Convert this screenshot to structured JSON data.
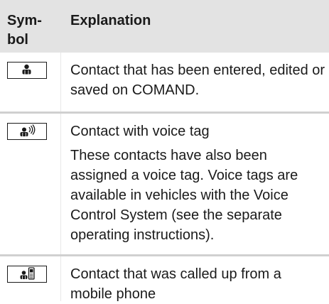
{
  "table": {
    "header": {
      "symbol": "Sym-\nbol",
      "explanation": "Explanation"
    },
    "rows": [
      {
        "icon": "contact-person-icon",
        "paragraphs": [
          "Contact that has been entered, edited or saved on COMAND."
        ]
      },
      {
        "icon": "contact-voice-tag-icon",
        "paragraphs": [
          "Contact with voice tag",
          "These contacts have also been assigned a voice tag. Voice tags are available in vehicles with the Voice Control System (see the separate operating instructions)."
        ]
      },
      {
        "icon": "contact-mobile-phone-icon",
        "paragraphs": [
          "Contact that was called up from a mobile phone"
        ]
      }
    ]
  }
}
